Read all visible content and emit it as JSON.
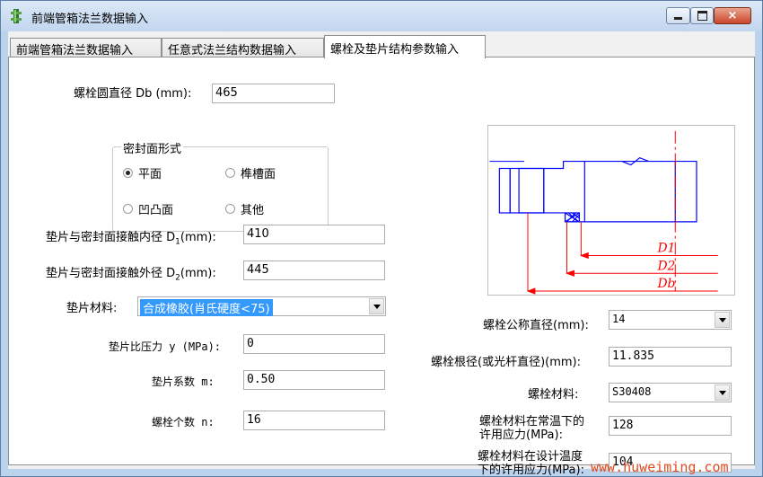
{
  "window": {
    "title": "前端管箱法兰数据输入",
    "controls": {
      "minimize": "minimize-icon",
      "maximize": "maximize-icon",
      "close": "×"
    }
  },
  "tabs": [
    "前端管箱法兰数据输入",
    "任意式法兰结构数据输入",
    "螺栓及垫片结构参数输入"
  ],
  "active_tab": 2,
  "form": {
    "bolt_circle_label": "螺栓圆直径 Db (mm):",
    "bolt_circle_value": "465",
    "seal_group_title": "密封面形式",
    "seal_options": [
      "平面",
      "榫槽面",
      "凹凸面",
      "其他"
    ],
    "seal_selected": "平面",
    "gasket_inner_label": "垫片与密封面接触内径 D",
    "gasket_inner_sub": "1",
    "gasket_inner_unit": "(mm):",
    "gasket_inner_value": "410",
    "gasket_outer_label": "垫片与密封面接触外径 D",
    "gasket_outer_sub": "2",
    "gasket_outer_unit": "(mm):",
    "gasket_outer_value": "445",
    "gasket_material_label": "垫片材料:",
    "gasket_material_value": "合成橡胶(肖氏硬度<75)",
    "gasket_y_label": "垫片比压力 y (MPa):",
    "gasket_y_value": "0",
    "gasket_m_label": "垫片系数 m:",
    "gasket_m_value": "0.50",
    "bolt_count_label": "螺栓个数 n:",
    "bolt_count_value": "16",
    "bolt_nominal_label": "螺栓公称直径(mm):",
    "bolt_nominal_value": "14",
    "bolt_root_label": "螺栓根径(或光杆直径)(mm):",
    "bolt_root_value": "11.835",
    "bolt_material_label": "螺栓材料:",
    "bolt_material_value": "S30408",
    "bolt_allow_normal_label_1": "螺栓材料在常温下的",
    "bolt_allow_normal_label_2": "许用应力(MPa):",
    "bolt_allow_normal_value": "128",
    "bolt_allow_design_label_1": "螺栓材料在设计温度",
    "bolt_allow_design_label_2": "下的许用应力(MPa):",
    "bolt_allow_design_value": "104"
  },
  "diagram": {
    "labels": {
      "d1": "D1",
      "d2": "D2",
      "db": "Db"
    },
    "colors": {
      "outline": "#0000ff",
      "dimension": "#ff0000"
    }
  },
  "watermark": "www.huweiming.com",
  "colors": {
    "selection": "#3399ff",
    "watermark": "#e24a1f"
  }
}
